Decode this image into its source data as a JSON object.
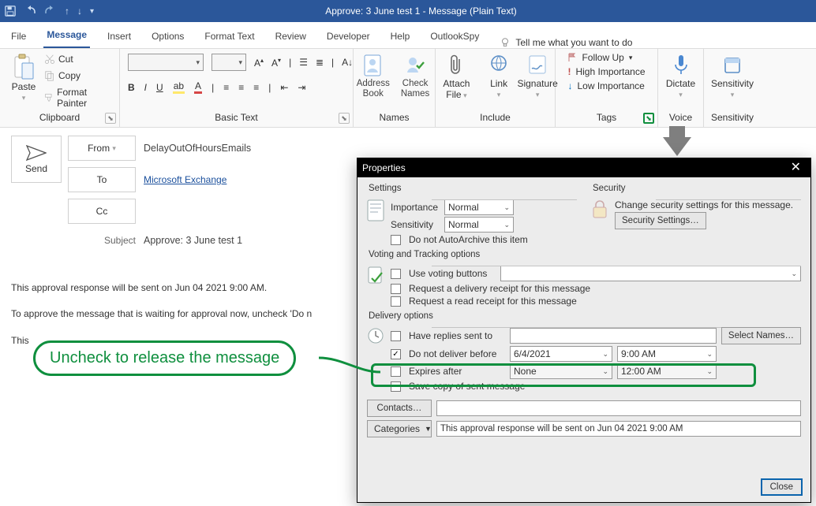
{
  "title": "Approve: 3 June test 1  -  Message (Plain Text)",
  "qat": {
    "save": "save-icon",
    "undo": "undo-icon",
    "redo": "redo-icon",
    "up": "↑",
    "down": "↓",
    "more": "▾"
  },
  "menu": {
    "file": "File",
    "message": "Message",
    "insert": "Insert",
    "options": "Options",
    "format": "Format Text",
    "review": "Review",
    "developer": "Developer",
    "help": "Help",
    "spy": "OutlookSpy",
    "tellme": "Tell me what you want to do"
  },
  "ribbon": {
    "clipboard": {
      "paste": "Paste",
      "cut": "Cut",
      "copy": "Copy",
      "painter": "Format Painter",
      "group": "Clipboard"
    },
    "basic": {
      "group": "Basic Text"
    },
    "names": {
      "address": "Address Book",
      "check": "Check Names",
      "group": "Names"
    },
    "include": {
      "attach": "Attach File",
      "link": "Link",
      "signature": "Signature",
      "group": "Include"
    },
    "tags": {
      "follow": "Follow Up",
      "high": "High Importance",
      "low": "Low Importance",
      "group": "Tags"
    },
    "voice": {
      "dictate": "Dictate",
      "group": "Voice"
    },
    "sens": {
      "sens": "Sensitivity",
      "group": "Sensitivity"
    }
  },
  "compose": {
    "send": "Send",
    "from": "From",
    "fromVal": "DelayOutOfHoursEmails",
    "to": "To",
    "toVal": "Microsoft Exchange",
    "cc": "Cc",
    "subject": "Subject",
    "subjectVal": "Approve: 3 June test 1",
    "body1": "This approval response  will be sent on  Jun 04 2021   9:00 AM.",
    "body2": "To approve the message that is waiting for approval now, uncheck 'Do n",
    "body3": "This"
  },
  "callout": "Uncheck to release the message",
  "dlg": {
    "title": "Properties",
    "settings": "Settings",
    "security": "Security",
    "importance": "Importance",
    "importanceVal": "Normal",
    "sensitivity": "Sensitivity",
    "sensitivityVal": "Normal",
    "noAuto": "Do not AutoArchive this item",
    "secMsg": "Change security settings for this message.",
    "secBtn": "Security Settings…",
    "voting": "Voting and Tracking options",
    "useVoting": "Use voting buttons",
    "reqDel": "Request a delivery receipt for this message",
    "reqRead": "Request a read receipt for this message",
    "delivery": "Delivery options",
    "haveReplies": "Have replies sent to",
    "selectNames": "Select Names…",
    "dnd": "Do not deliver before",
    "date": "6/4/2021",
    "time": "9:00 AM",
    "expires": "Expires after",
    "expDate": "None",
    "expTime": "12:00 AM",
    "saveCopy": "Save copy of sent message",
    "contacts": "Contacts…",
    "categories": "Categories",
    "catVal": "This approval response  will be sent on  Jun 04 2021 9:00 AM",
    "close": "Close"
  }
}
